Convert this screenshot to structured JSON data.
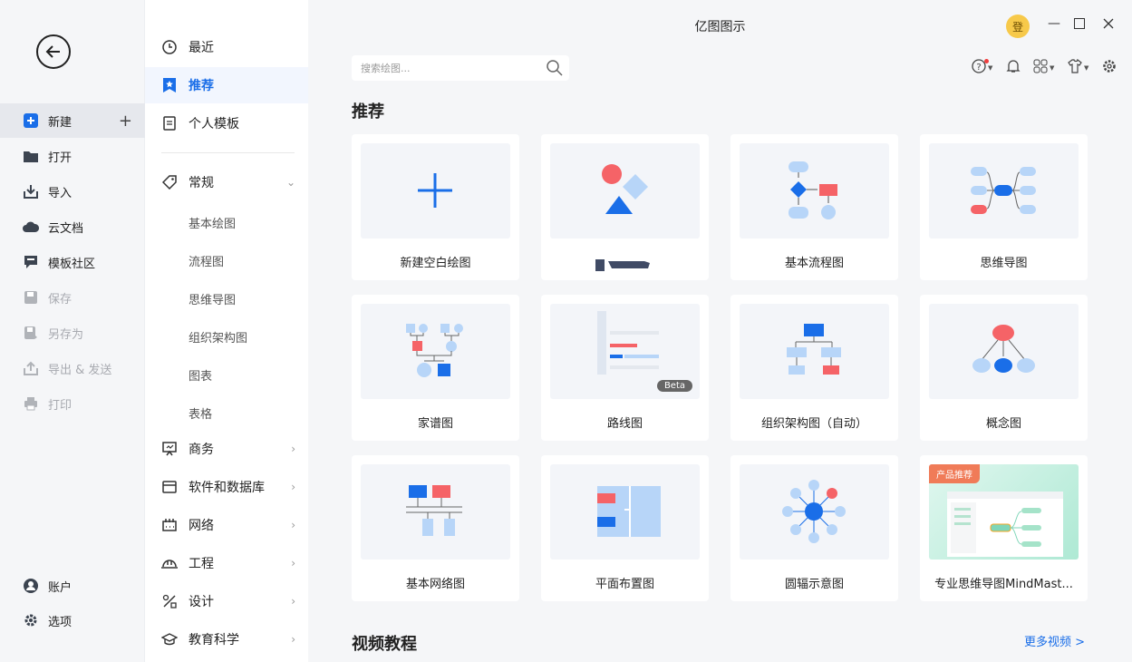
{
  "app": {
    "title": "亿图图示"
  },
  "window": {
    "avatar_text": "登"
  },
  "colors": {
    "accent": "#1a6ee8",
    "red": "#f56367",
    "light_blue": "#b7d5f8"
  },
  "left_nav": {
    "back_icon": "arrow-left-icon",
    "items": [
      {
        "label": "新建",
        "icon": "new-plus-icon"
      },
      {
        "label": "打开",
        "icon": "folder-icon"
      },
      {
        "label": "导入",
        "icon": "import-icon"
      },
      {
        "label": "云文档",
        "icon": "cloud-icon"
      },
      {
        "label": "模板社区",
        "icon": "community-icon"
      },
      {
        "label": "保存",
        "icon": "save-icon"
      },
      {
        "label": "另存为",
        "icon": "save-as-icon"
      },
      {
        "label": "导出 & 发送",
        "icon": "export-icon"
      },
      {
        "label": "打印",
        "icon": "print-icon"
      }
    ],
    "bottom": [
      {
        "label": "账户",
        "icon": "account-icon"
      },
      {
        "label": "选项",
        "icon": "gear-icon"
      }
    ]
  },
  "category_nav": {
    "top": [
      {
        "label": "最近"
      },
      {
        "label": "推荐"
      },
      {
        "label": "个人模板"
      }
    ],
    "general": {
      "label": "常规",
      "subs": [
        "基本绘图",
        "流程图",
        "思维导图",
        "组织架构图",
        "图表",
        "表格"
      ]
    },
    "groups": [
      {
        "label": "商务"
      },
      {
        "label": "软件和数据库"
      },
      {
        "label": "网络"
      },
      {
        "label": "工程"
      },
      {
        "label": "设计"
      },
      {
        "label": "教育科学"
      }
    ]
  },
  "search": {
    "placeholder": "搜索绘图..."
  },
  "recommend": {
    "title": "推荐",
    "cards": [
      {
        "label": "新建空白绘图"
      },
      {
        "label": ""
      },
      {
        "label": "基本流程图"
      },
      {
        "label": "思维导图"
      },
      {
        "label": "家谱图"
      },
      {
        "label": "路线图",
        "badge": "Beta"
      },
      {
        "label": "组织架构图（自动）"
      },
      {
        "label": "概念图"
      },
      {
        "label": "基本网络图"
      },
      {
        "label": "平面布置图"
      },
      {
        "label": "圆辐示意图"
      },
      {
        "label": "专业思维导图MindMast...",
        "tag": "产品推荐"
      }
    ]
  },
  "video": {
    "title": "视频教程",
    "more": "更多视频 >"
  }
}
